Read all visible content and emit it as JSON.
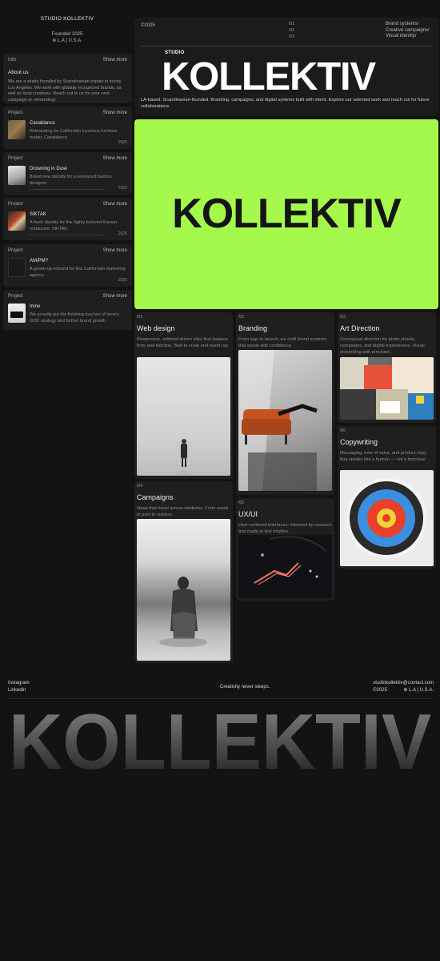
{
  "brand": {
    "name": "STUDIO KOLLEKTIV",
    "founded": "Founded 2025",
    "location": "⊕ L.A | U.S.A."
  },
  "info": {
    "label": "Info",
    "more": "Show more",
    "title": "About us",
    "text": "We are a studio founded by Scandinavian expats in sunny Los Angeles. We work with globally recognized brands, as well as local creatives. Reach out to us for your next campaign or rebranding!"
  },
  "projects": [
    {
      "label": "Project",
      "more": "Show more",
      "title": "Casablanco",
      "desc": "Rebranding for Californian luxurious furniture maker, Casablanco.",
      "year": "2025",
      "thumb_color": "#7a6a4a"
    },
    {
      "label": "Project",
      "more": "Show more",
      "title": "Drowning in Dusk",
      "desc": "Brand new identity for a renowned fashion designer.",
      "year": "2025",
      "thumb_color": "#cfcfcf"
    },
    {
      "label": "Project",
      "more": "Show more",
      "title": "SIKTAK",
      "desc": "A fresh identity for the highly beloved Korean restaurant, SIKTAK.",
      "year": "2025",
      "thumb_color": "#8a3a2a"
    },
    {
      "label": "Project",
      "more": "Show more",
      "title": "AM/PM?",
      "desc": "A grown-up rebrand for this Californian marketing agency.",
      "year": "2025",
      "thumb_color": "#1f1f1f"
    },
    {
      "label": "Project",
      "more": "Show more",
      "title": "tmrw",
      "desc": "We proudly put the finishing touches of tmrw's 2026 strategy and further brand growth.",
      "year": "",
      "thumb_color": "#e6e6e6"
    }
  ],
  "hero": {
    "copyright": "©2025",
    "nums": [
      "/01",
      "/02",
      "/03"
    ],
    "tags": [
      "Brand systems/",
      "Creative campaigns/",
      "Visual identity/"
    ],
    "studio": "STUDIO",
    "logo": "KOLLEKTIV",
    "tagline": "LA-based. Scandinavian-founded. Branding, campaigns, and digital systems built with intent. Explore our selected work and reach out for future collaborations."
  },
  "green_logo": "KOLLEKTIV",
  "services": [
    {
      "num": "/01",
      "title": "Web design",
      "desc": "Responsive, editorial-driven sites that balance form and function. Built to scale and stand out."
    },
    {
      "num": "/02",
      "title": "Branding",
      "desc": "From logo to launch, we craft brand systems that speak with confidence."
    },
    {
      "num": "/03",
      "title": "Art Direction",
      "desc": "Conceptual direction for photo shoots, campaigns, and digital experiences. Visual storytelling with precision."
    },
    {
      "num": "/04",
      "title": "Campaigns",
      "desc": "Ideas that travel across mediums. From social to print to outdoor."
    },
    {
      "num": "/05",
      "title": "UX/UI",
      "desc": "User-centered interfaces, informed by research and made to feel intuitive."
    },
    {
      "num": "/06",
      "title": "Copywriting",
      "desc": "Messaging, tone of voice, and product copy that speaks like a human — not a brochure."
    }
  ],
  "footer": {
    "links": [
      "Instagram",
      "Linkedin"
    ],
    "slogan": "Creativity never sleeps.",
    "email": "studiokollektiv@contact.com",
    "copyright": "©2025",
    "location": "⊕ L.A | U.S.A.",
    "mega": "KOLLEKTIV"
  },
  "colors": {
    "accent": "#a5f94c",
    "background": "#131313",
    "card": "#1f1f1f"
  }
}
